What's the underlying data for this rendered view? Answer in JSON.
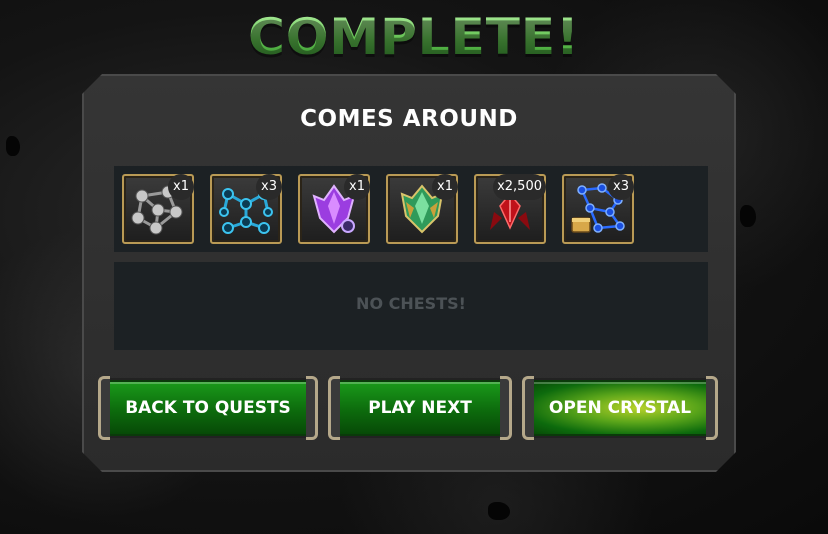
{
  "header": {
    "title": "COMPLETE!"
  },
  "quest": {
    "name": "COMES AROUND"
  },
  "rewards": [
    {
      "icon": "silver-catalyst-icon",
      "qty": "x1"
    },
    {
      "icon": "blue-catalyst-icon",
      "qty": "x3"
    },
    {
      "icon": "purple-crystal-icon",
      "qty": "x1"
    },
    {
      "icon": "green-crystal-icon",
      "qty": "x1"
    },
    {
      "icon": "battlechip-icon",
      "qty": "x2,500"
    },
    {
      "icon": "blue-catalyst-crate-icon",
      "qty": "x3"
    }
  ],
  "chests": {
    "empty_label": "NO CHESTS!"
  },
  "buttons": {
    "back": "BACK TO QUESTS",
    "next": "PLAY NEXT",
    "crystal": "OPEN CRYSTAL"
  },
  "colors": {
    "title_green": "#7fd66e",
    "button_green": "#0d6b0d",
    "frame_gold": "#b99a55"
  }
}
